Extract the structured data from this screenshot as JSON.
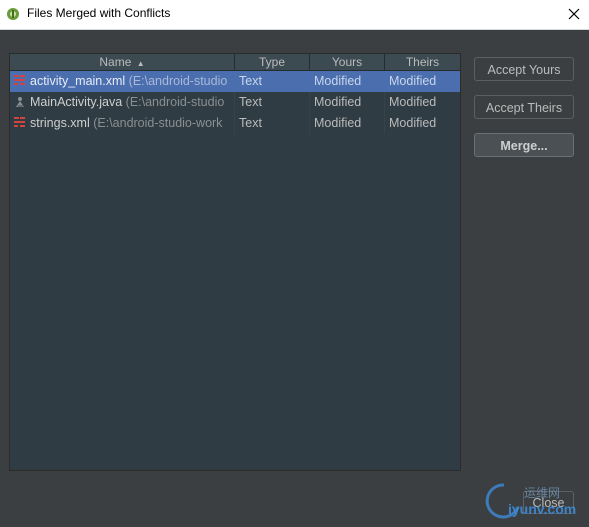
{
  "window": {
    "title": "Files Merged with Conflicts",
    "close_icon": "close-icon",
    "app_icon": "android-studio-icon"
  },
  "table": {
    "columns": [
      {
        "label": "Name",
        "sort_indicator": "▲"
      },
      {
        "label": "Type"
      },
      {
        "label": "Yours"
      },
      {
        "label": "Theirs"
      }
    ],
    "rows": [
      {
        "name": "activity_main.xml",
        "path": "(E:\\android-studio",
        "type": "Text",
        "yours": "Modified",
        "theirs": "Modified",
        "icon": "xml-file-icon",
        "selected": true
      },
      {
        "name": "MainActivity.java",
        "path": "(E:\\android-studio",
        "type": "Text",
        "yours": "Modified",
        "theirs": "Modified",
        "icon": "java-class-icon",
        "selected": false
      },
      {
        "name": "strings.xml",
        "path": "(E:\\android-studio-work",
        "type": "Text",
        "yours": "Modified",
        "theirs": "Modified",
        "icon": "xml-file-icon",
        "selected": false
      }
    ]
  },
  "buttons": {
    "accept_yours": "Accept Yours",
    "accept_theirs": "Accept Theirs",
    "merge": "Merge...",
    "close": "Close"
  },
  "watermark": {
    "top": "运维网",
    "bottom": "iyunv.com"
  },
  "colors": {
    "selection": "#4b6eaf",
    "panel": "#2f3c43",
    "dialog": "#3c3f41"
  }
}
